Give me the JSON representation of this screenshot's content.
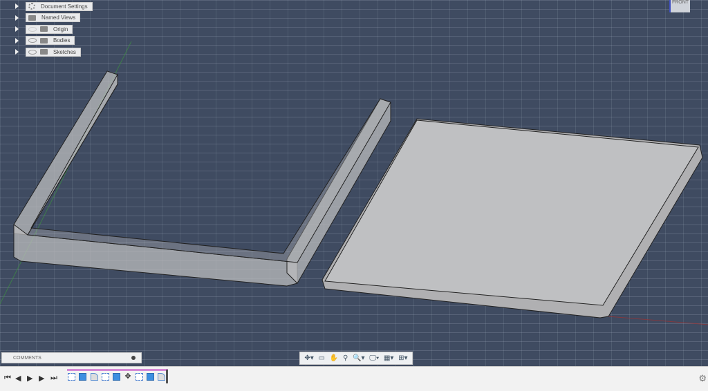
{
  "browser": {
    "items": [
      {
        "label": "Document Settings",
        "icon": "gear-icon"
      },
      {
        "label": "Named Views",
        "icon": "folder-icon"
      },
      {
        "label": "Origin",
        "icon": "folder-icon",
        "visibility": "hidden"
      },
      {
        "label": "Bodies",
        "icon": "folder-icon",
        "visibility": "visible"
      },
      {
        "label": "Sketches",
        "icon": "folder-icon",
        "visibility": "visible"
      }
    ]
  },
  "viewcube": {
    "face": "FRONT"
  },
  "comments": {
    "label": "COMMENTS"
  },
  "navbar": {
    "tools": [
      "orbit",
      "look-at",
      "pan",
      "zoom-window",
      "fit",
      "display-settings",
      "grid-settings",
      "viewports"
    ]
  },
  "timeline": {
    "controls": [
      "first",
      "previous",
      "play",
      "next",
      "last"
    ],
    "features": [
      "sketch",
      "extrude",
      "fillet",
      "sketch",
      "extrude",
      "move",
      "sketch",
      "extrude",
      "fillet"
    ]
  },
  "colors": {
    "viewport": "#3f4b61",
    "body": "#bfbfc0",
    "timeline_bar": "#d58ad6"
  }
}
